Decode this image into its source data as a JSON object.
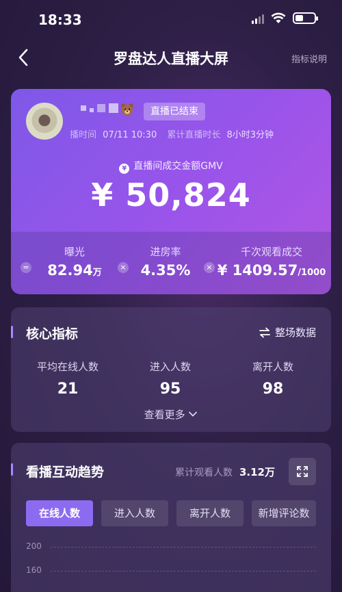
{
  "status_bar": {
    "time": "18:33"
  },
  "nav": {
    "title": "罗盘达人直播大屏",
    "help": "指标说明"
  },
  "hero": {
    "status_badge": "直播已结束",
    "start_label": "播时间",
    "start_time": "07/11 10:30",
    "duration_label": "累计直播时长",
    "duration": "8小时3分钟",
    "gmv_label": "直播间成交金额GMV",
    "gmv_value": "¥ 50,824",
    "coin_symbol": "¥"
  },
  "stats": [
    {
      "label": "曝光",
      "value": "82.94",
      "unit": "万"
    },
    {
      "label": "进房率",
      "value": "4.35%",
      "unit": ""
    },
    {
      "label": "千次观看成交",
      "value": "¥ 1409.57",
      "unit": "/1000"
    }
  ],
  "stat_ops": [
    "=",
    "×",
    "×"
  ],
  "core": {
    "title": "核心指标",
    "full_data": "整场数据",
    "metrics": [
      {
        "label": "平均在线人数",
        "value": "21"
      },
      {
        "label": "进入人数",
        "value": "95"
      },
      {
        "label": "离开人数",
        "value": "98"
      }
    ],
    "see_more": "查看更多"
  },
  "trend": {
    "title": "看播互动趋势",
    "total_label": "累计观看人数",
    "total_value": "3.12万",
    "tabs": [
      "在线人数",
      "进入人数",
      "离开人数",
      "新增评论数"
    ],
    "active_tab": 0,
    "y_ticks": [
      "200",
      "160"
    ]
  },
  "colors": {
    "accent": "#8d6bf1",
    "hero_start": "#7e58e8",
    "hero_end": "#b257e2"
  },
  "icons": [
    "back-icon",
    "signal-icon",
    "wifi-icon",
    "battery-icon",
    "bear-icon",
    "coin-icon",
    "swap-icon",
    "chevron-down-icon",
    "expand-icon"
  ]
}
